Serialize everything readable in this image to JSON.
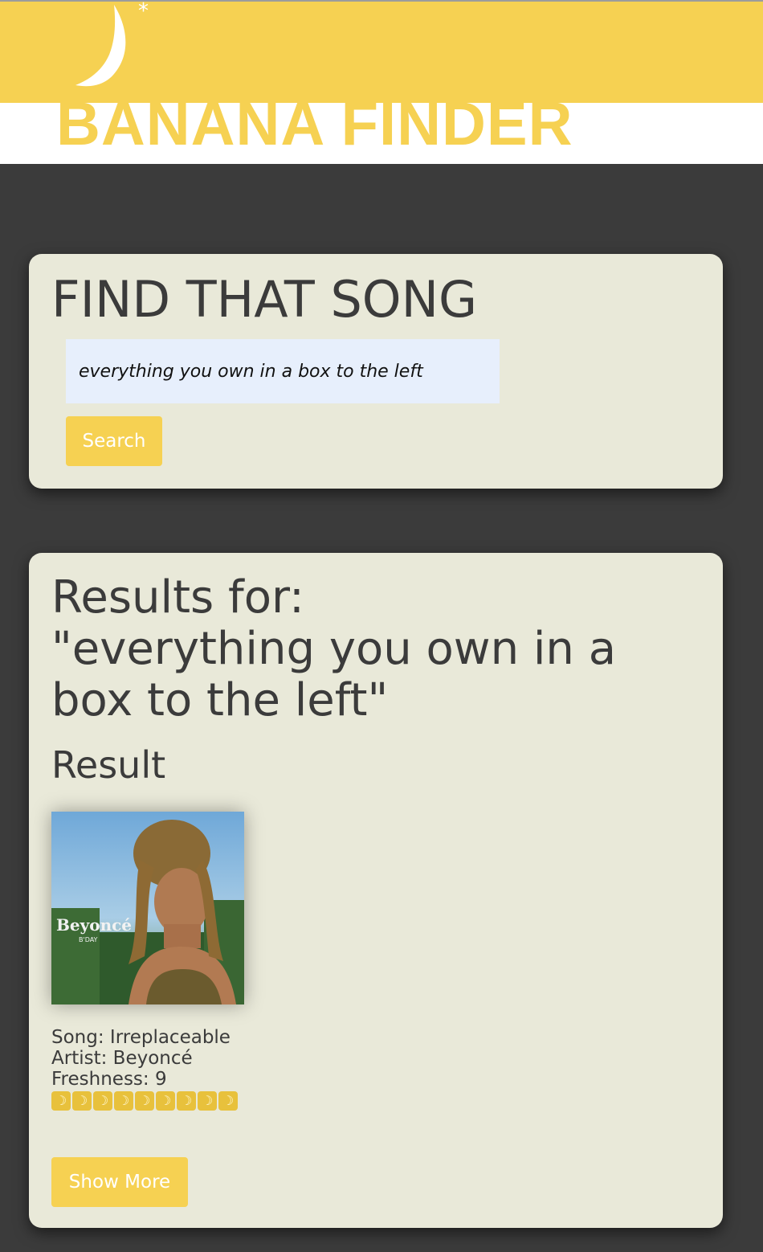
{
  "header": {
    "brand_title": "BANANA FINDER",
    "logo_icon": "banana-logo-icon",
    "accent_color": "#f6d152"
  },
  "search": {
    "title": "FIND THAT SONG",
    "input_value": "everything you own in a box to the left",
    "button_label": "Search"
  },
  "results": {
    "heading_line1": "Results for:",
    "heading_line2": "\"everything you own in a box to the left\"",
    "subheading": "Result",
    "song_line": "Song: Irreplaceable",
    "artist_line": "Artist: Beyoncé",
    "freshness_line": "Freshness: 9",
    "freshness_value": 9,
    "rating_icon": "banana-icon",
    "rating_icons_shown": 9,
    "album_art_text": "Beyoncé",
    "album_art_subtext": "B'DAY",
    "show_more_label": "Show More"
  }
}
